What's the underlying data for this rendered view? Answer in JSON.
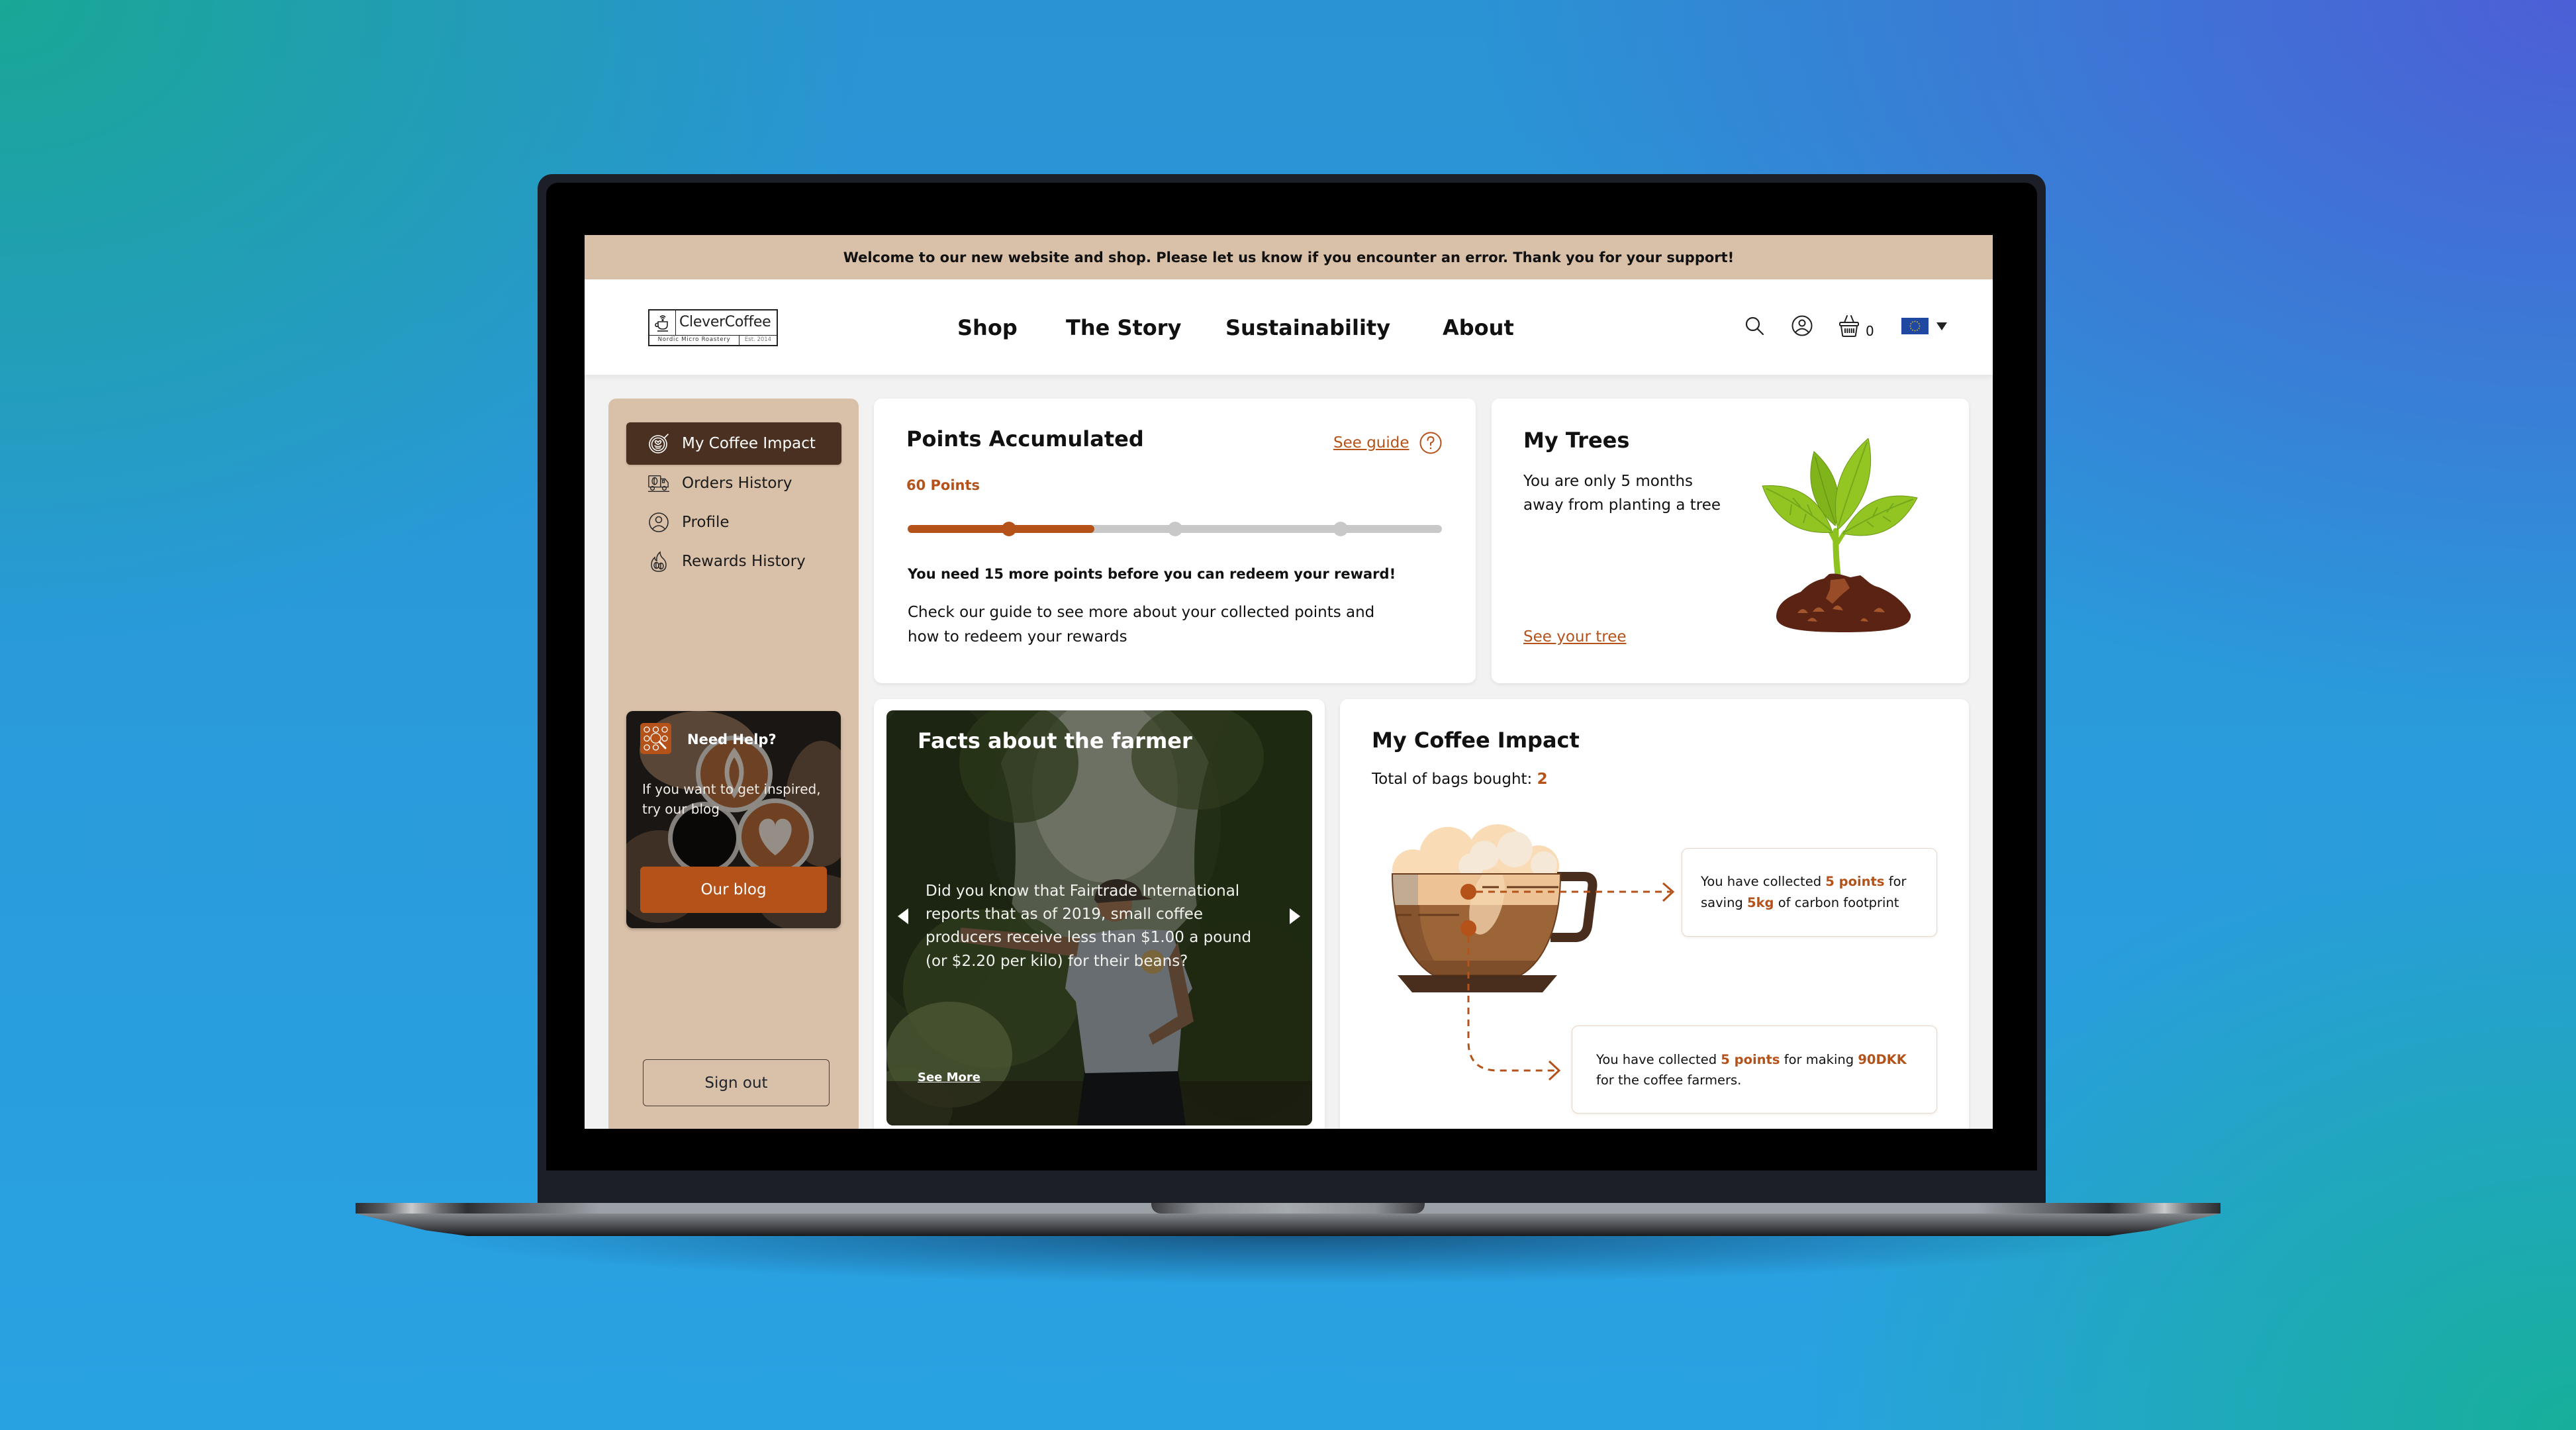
{
  "banner": {
    "text": "Welcome to our new website and shop. Please let us know if you encounter an error. Thank you for your support!"
  },
  "header": {
    "logo": {
      "name": "CleverCoffee",
      "tagline": "Nordic Micro Roastery",
      "established": "Est. 2014"
    },
    "nav": [
      {
        "label": "Shop"
      },
      {
        "label": "The Story"
      },
      {
        "label": "Sustainability"
      },
      {
        "label": "About"
      }
    ],
    "actions": [
      {
        "icon": "search-icon"
      },
      {
        "icon": "user-icon"
      },
      {
        "icon": "basket-icon"
      }
    ],
    "cart_count": "0",
    "region": {
      "icon": "eu-flag-icon",
      "dropdown_icon": "caret-down-icon"
    }
  },
  "sidebar": {
    "items": [
      {
        "label": "My Coffee Impact",
        "icon": "latte-art-icon",
        "active": true
      },
      {
        "label": "Orders History",
        "icon": "delivery-truck-icon",
        "active": false
      },
      {
        "label": "Profile",
        "icon": "user-circle-icon",
        "active": false
      },
      {
        "label": "Rewards History",
        "icon": "flame-beans-icon",
        "active": false
      }
    ],
    "help_card": {
      "title": "Need Help?",
      "text_lines": [
        "If you want to get inspired,",
        "try our blog"
      ],
      "button": "Our blog"
    },
    "sign_out": "Sign out"
  },
  "points": {
    "title": "Points Accumulated",
    "guide_link": "See guide",
    "value": "60 Points",
    "progress": {
      "fraction": 0.35,
      "milestones": [
        {
          "at": 0.19,
          "reached": true
        },
        {
          "at": 0.5,
          "reached": false
        },
        {
          "at": 0.81,
          "reached": false
        }
      ]
    },
    "notice": "You need 15 more points before you can redeem your reward!",
    "description_lines": [
      "Check our guide to see more about your collected points and",
      "how to redeem your rewards"
    ]
  },
  "trees": {
    "title": "My Trees",
    "text_lines": [
      "You are only 5 months",
      "away from planting a tree"
    ],
    "link": "See your tree"
  },
  "facts": {
    "title": "Facts about the farmer",
    "text_lines": [
      "Did you know that Fairtrade International",
      "reports that as of 2019, small coffee",
      "producers receive less than $1.00 a pound",
      "(or $2.20 per kilo) for their beans?"
    ],
    "link": "See More"
  },
  "impact": {
    "title": "My Coffee Impact",
    "bags_label": "Total of bags bought: ",
    "bags_value": "2",
    "carbon": {
      "l1_pre": "You have collected ",
      "points": "5 points",
      "l1_post": " for",
      "l2_pre": "saving ",
      "amount": "5kg",
      "l2_post": " of carbon footprint"
    },
    "farmers": {
      "l1_pre": "You have collected ",
      "points": "5 points",
      "l1_mid": " for making ",
      "amount": "90DKK",
      "l2": "for the coffee farmers."
    }
  },
  "colors": {
    "accent": "#b5521a",
    "tan": "#d9c0a8",
    "dark_brown": "#4a3020",
    "progress_track": "#c8c8c8",
    "page_bg": "#f2f2f2"
  }
}
